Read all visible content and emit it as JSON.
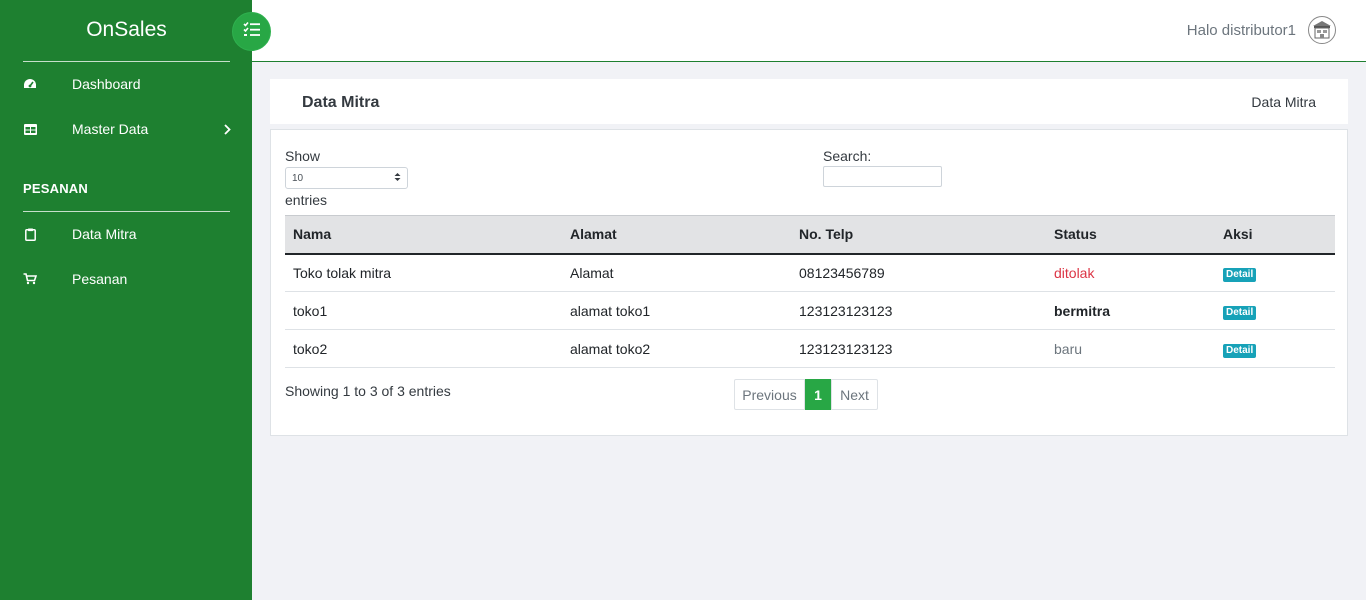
{
  "app": {
    "brand": "OnSales"
  },
  "sidebar": {
    "items": [
      {
        "label": "Dashboard",
        "icon": "tachometer-icon"
      },
      {
        "label": "Master Data",
        "icon": "table-icon"
      },
      {
        "label": "Data Mitra",
        "icon": "clipboard-icon"
      },
      {
        "label": "Pesanan",
        "icon": "cart-icon"
      }
    ],
    "section_label": "PESANAN"
  },
  "topbar": {
    "greeting": "Halo distributor1",
    "avatar_icon": "store-avatar-icon"
  },
  "page": {
    "title": "Data Mitra",
    "breadcrumb": "Data Mitra"
  },
  "table_controls": {
    "show_label": "Show",
    "length_value": "10",
    "entries_label": "entries",
    "search_label": "Search:",
    "search_value": ""
  },
  "table": {
    "headers": [
      "Nama",
      "Alamat",
      "No. Telp",
      "Status",
      "Aksi"
    ],
    "rows": [
      {
        "nama": "Toko tolak mitra",
        "alamat": "Alamat",
        "telp": "08123456789",
        "status": "ditolak",
        "aksi": "Detail"
      },
      {
        "nama": "toko1",
        "alamat": "alamat toko1",
        "telp": "123123123123",
        "status": "bermitra",
        "aksi": "Detail"
      },
      {
        "nama": "toko2",
        "alamat": "alamat toko2",
        "telp": "123123123123",
        "status": "baru",
        "aksi": "Detail"
      }
    ]
  },
  "pagination": {
    "info": "Showing 1 to 3 of 3 entries",
    "previous": "Previous",
    "current": "1",
    "next": "Next"
  },
  "colors": {
    "sidebar_bg": "#1e8030",
    "accent": "#28a745",
    "badge_bg": "#17a2b8",
    "status_rejected": "#dc3545"
  }
}
